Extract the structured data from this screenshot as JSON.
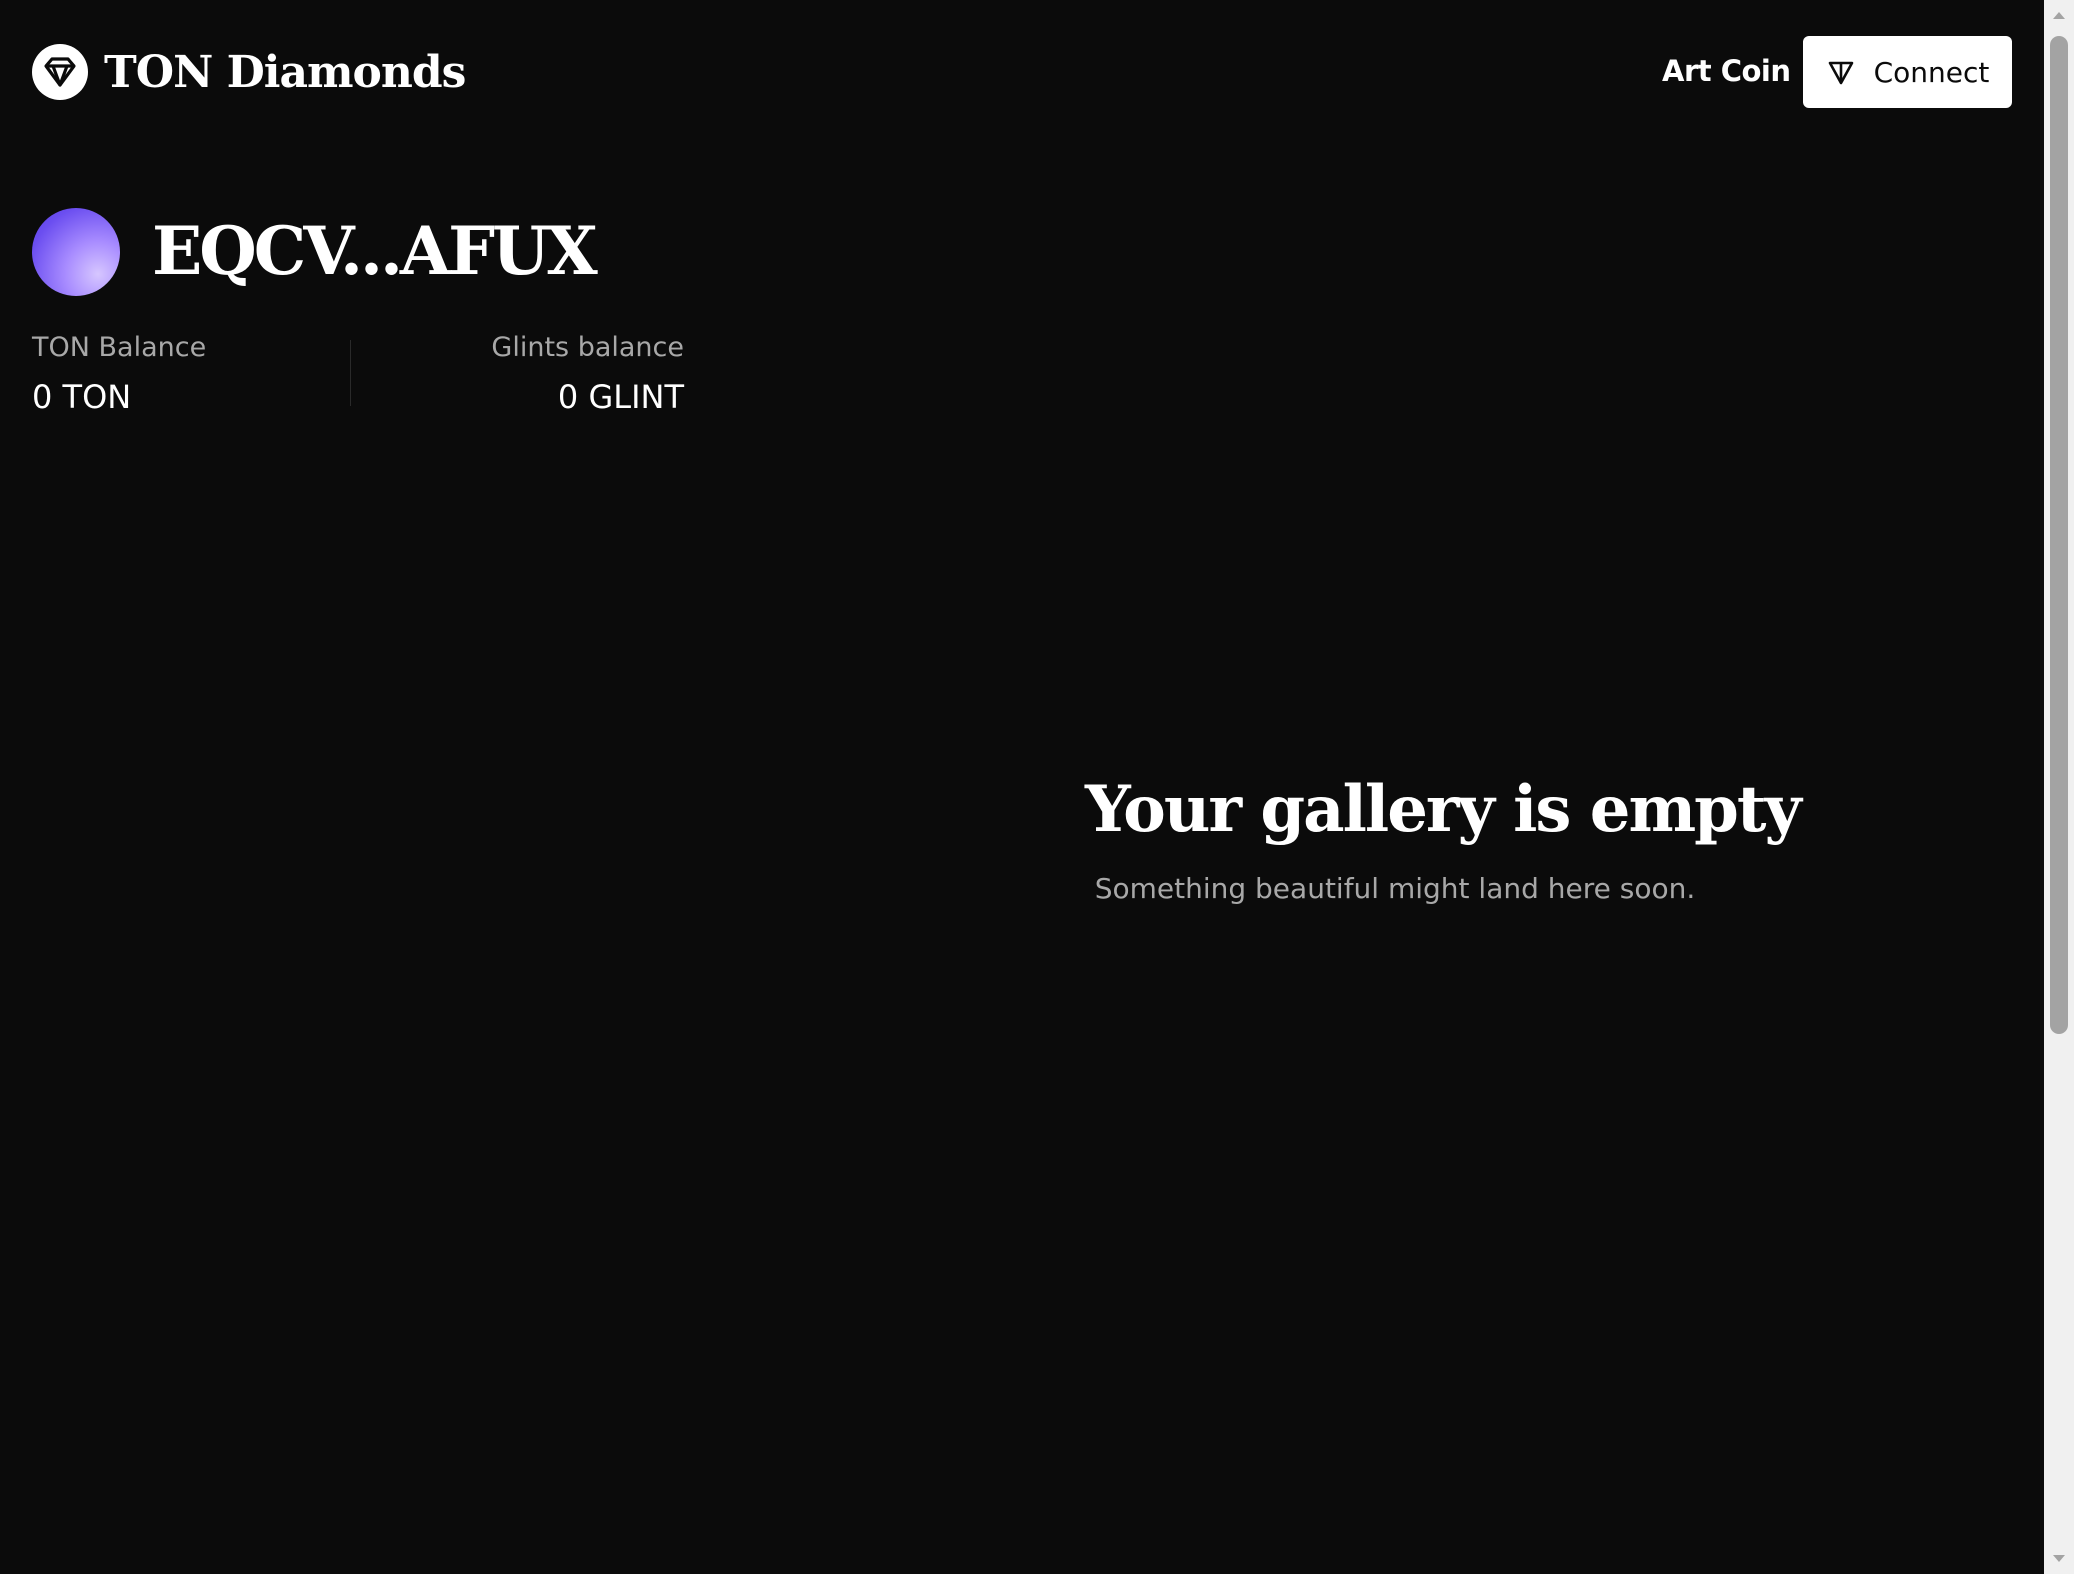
{
  "header": {
    "brand_name": "TON Diamonds",
    "brand_icon": "diamond-icon",
    "nav_link": "Art Coin",
    "connect_label": "Connect",
    "connect_icon": "ton-icon"
  },
  "profile": {
    "address": "EQCV...AFUX",
    "ton_balance_label": "TON Balance",
    "ton_balance_value": "0 TON",
    "glints_balance_label": "Glints balance",
    "glints_balance_value": "0 GLINT"
  },
  "gallery": {
    "empty_title": "Your gallery is empty",
    "empty_subtitle": "Something beautiful might land here soon."
  },
  "colors": {
    "background": "#0b0b0b",
    "text": "#ffffff",
    "muted_text": "#a8a8a8",
    "button_bg": "#ffffff",
    "avatar_accent": "#6b4ef0"
  }
}
